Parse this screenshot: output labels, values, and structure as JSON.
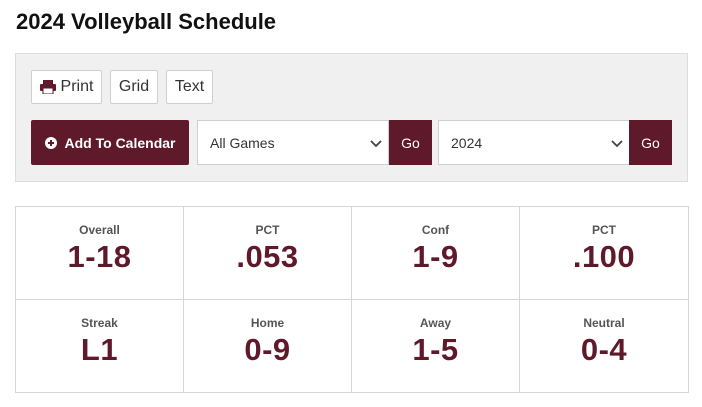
{
  "page": {
    "title": "2024 Volleyball Schedule"
  },
  "toolbar": {
    "print_label": "Print",
    "grid_label": "Grid",
    "text_label": "Text",
    "add_calendar_label": "Add To Calendar",
    "games_filter": {
      "selected": "All Games"
    },
    "year_filter": {
      "selected": "2024"
    },
    "go_label": "Go"
  },
  "stats": [
    {
      "label": "Overall",
      "value": "1-18"
    },
    {
      "label": "PCT",
      "value": ".053"
    },
    {
      "label": "Conf",
      "value": "1-9"
    },
    {
      "label": "PCT",
      "value": ".100"
    },
    {
      "label": "Streak",
      "value": "L1"
    },
    {
      "label": "Home",
      "value": "0-9"
    },
    {
      "label": "Away",
      "value": "1-5"
    },
    {
      "label": "Neutral",
      "value": "0-4"
    }
  ],
  "colors": {
    "accent": "#5e1a2a",
    "panel_bg": "#f0f0f0"
  },
  "icons": {
    "print": "printer-icon",
    "add": "plus-circle-icon",
    "dropdown": "chevron-down-icon"
  }
}
